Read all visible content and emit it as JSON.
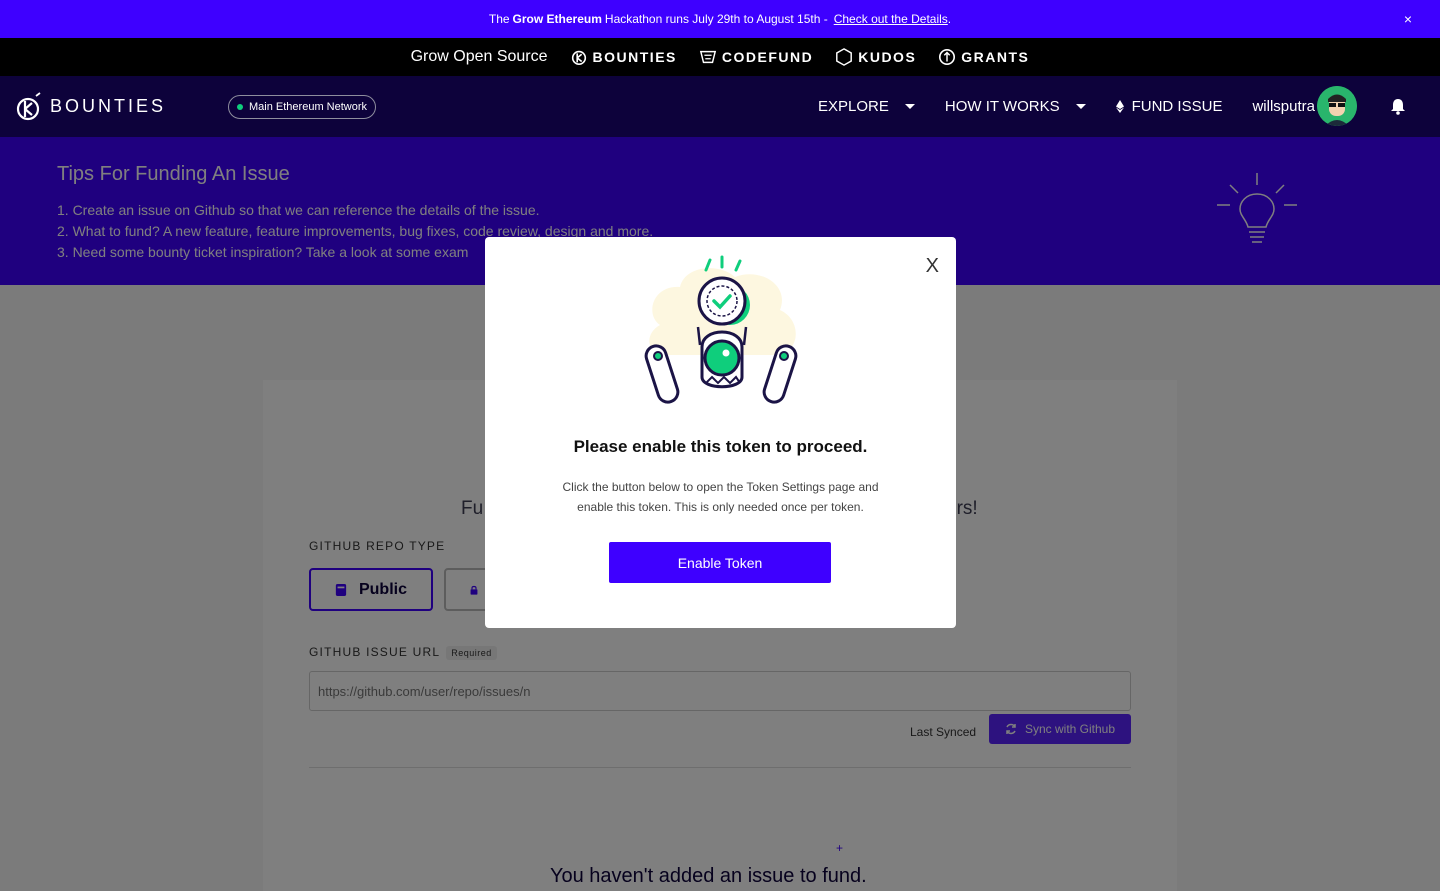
{
  "announcement": {
    "prefix": "The",
    "event": "Grow Ethereum",
    "middle": "Hackathon runs July 29th to August 15th -",
    "link": "Check out the Details",
    "suffix": ".",
    "close": "×"
  },
  "products": {
    "tagline": "Grow Open Source",
    "items": [
      {
        "label": "BOUNTIES",
        "icon": "bounties-icon"
      },
      {
        "label": "CODEFUND",
        "icon": "codefund-icon"
      },
      {
        "label": "KUDOS",
        "icon": "kudos-icon"
      },
      {
        "label": "GRANTS",
        "icon": "grants-icon"
      }
    ]
  },
  "nav": {
    "logo_text": "BOUNTIES",
    "network": "Main Ethereum Network",
    "explore": "EXPLORE",
    "how_it_works": "HOW IT WORKS",
    "fund_issue": "FUND ISSUE",
    "username": "willsputra"
  },
  "tips": {
    "title": "Tips For Funding An Issue",
    "items": [
      "1. Create an issue on Github so that we can reference the details of the issue.",
      "2. What to fund? A new feature, feature improvements, bug fixes, code review, design and more.",
      "3. Need some bounty ticket inspiration? Take a look at some exam"
    ]
  },
  "form": {
    "fund_line_left": "Fu",
    "fund_line_right": "ers!",
    "repo_type_label": "GITHUB REPO TYPE",
    "public_label": "Public",
    "issue_url_label": "GITHUB ISSUE URL",
    "required_badge": "Required",
    "url_placeholder": "https://github.com/user/repo/issues/n",
    "last_synced": "Last Synced",
    "sync_button": "Sync with Github",
    "empty_message": "You haven't added an issue to fund.",
    "plus": "+"
  },
  "modal": {
    "close": "X",
    "title": "Please enable this token to proceed.",
    "body": "Click the button below to open the Token Settings page and enable this token. This is only needed once per token.",
    "button": "Enable Token"
  },
  "colors": {
    "brand": "#3e00ff",
    "nav_bg": "#0d023b",
    "accent_green": "#0fce7c"
  }
}
